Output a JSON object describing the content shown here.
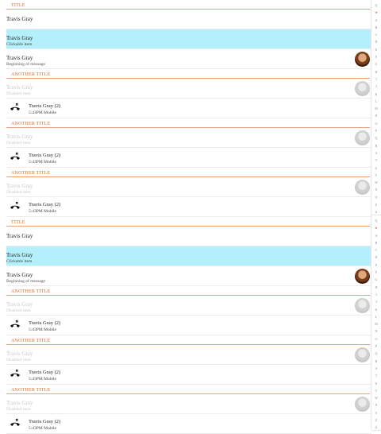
{
  "block": {
    "title": "TITLE",
    "simple_name": "Travis Gray",
    "clickable": {
      "name": "Travis Gray",
      "sub": "Clickable item"
    },
    "avatar_item": {
      "name": "Travis Gray",
      "sub": "Beginning of message"
    },
    "another_title": "ANOTHER TITLE",
    "disabled": {
      "name": "Travis Gray",
      "sub": "Disabled item"
    },
    "call": {
      "name": "Travis Gray (2)",
      "sub": "5:43PM  Mobile"
    }
  },
  "index_letters": [
    "Q",
    "★",
    "A",
    "B",
    "C",
    "D",
    "E",
    "F",
    "G",
    "H",
    "I",
    "J",
    "K",
    "L",
    "M",
    "N",
    "O",
    "P",
    "Q",
    "R",
    "S",
    "T",
    "U",
    "V",
    "W",
    "X",
    "Y",
    "Z",
    "#"
  ],
  "colors": {
    "accent": "#d56b2a",
    "clickable_bg": "#b3f0fb"
  },
  "icons": {
    "call": "missed-call-icon",
    "avatar": "contact-photo"
  }
}
